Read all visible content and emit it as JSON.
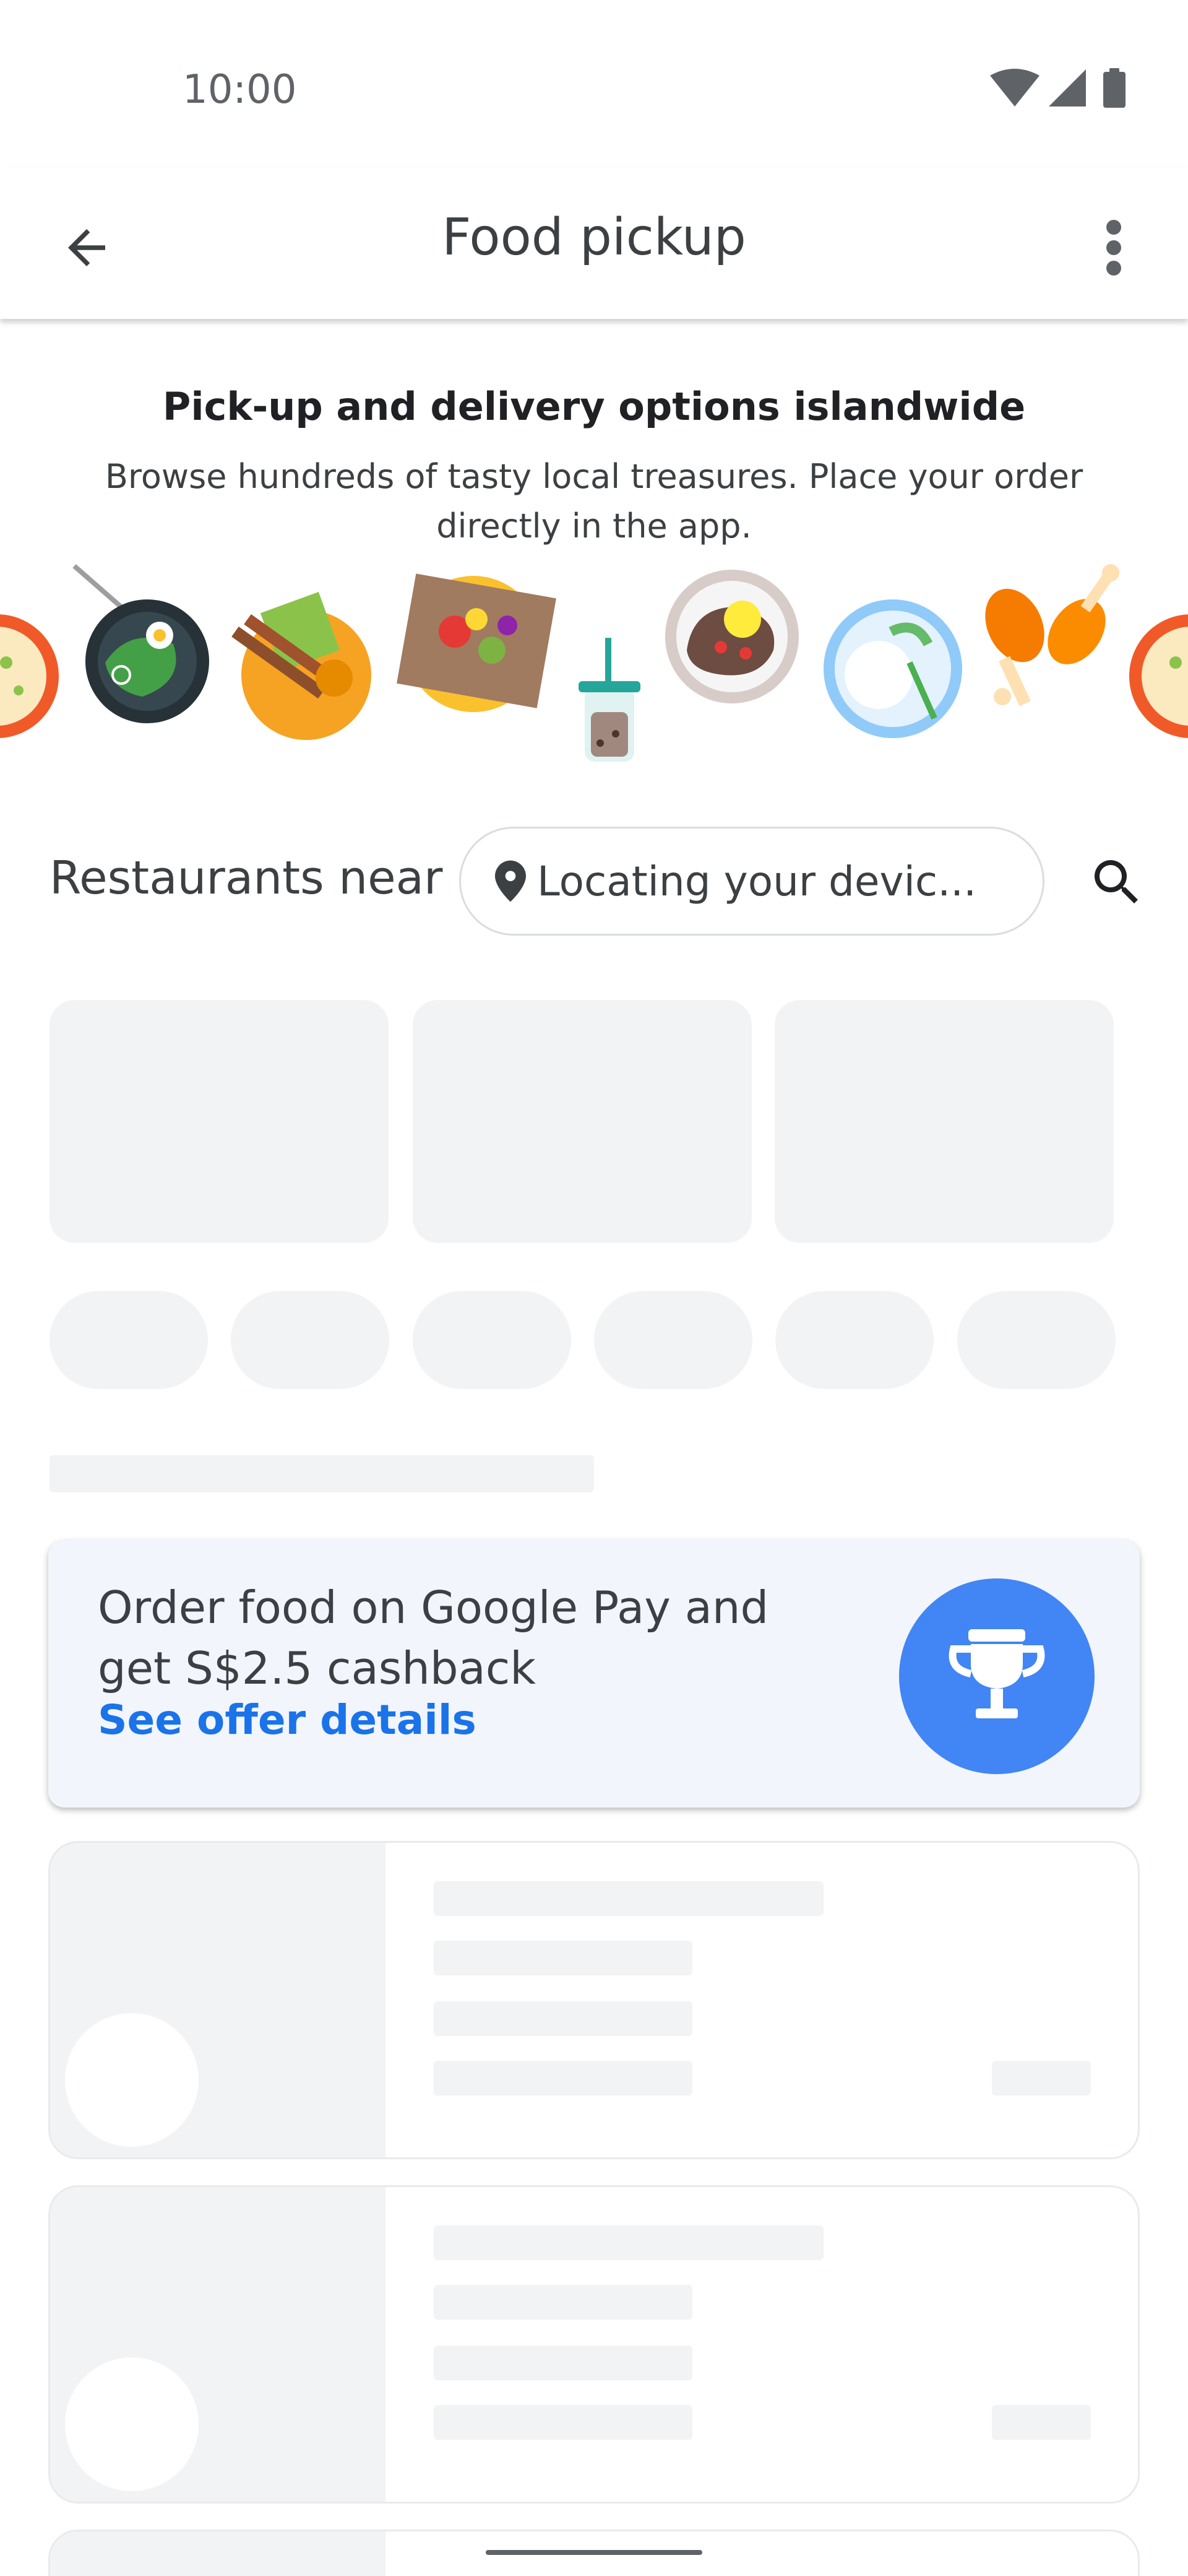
{
  "status_bar": {
    "time": "10:00",
    "icons": [
      "wifi-icon",
      "signal-icon",
      "battery-icon"
    ]
  },
  "app_bar": {
    "title": "Food pickup",
    "back_icon": "arrow-back-icon",
    "menu_icon": "more-vert-icon"
  },
  "promo": {
    "title": "Pick-up and delivery options islandwide",
    "subtitle": "Browse hundreds of tasty local treasures. Place your order directly in the app."
  },
  "restaurants": {
    "label": "Restaurants near",
    "location_placeholder": "Locating your devic...",
    "location_icon": "location-pin-icon",
    "search_icon": "search-icon"
  },
  "offer": {
    "text": "Order food on Google Pay and get S$2.5 cashback",
    "link": "See offer details",
    "icon": "trophy-icon"
  },
  "colors": {
    "accent": "#1a73e8",
    "badge": "#4285f4",
    "skeleton": "#f1f3f4",
    "offer_bg": "#f2f5fc"
  }
}
